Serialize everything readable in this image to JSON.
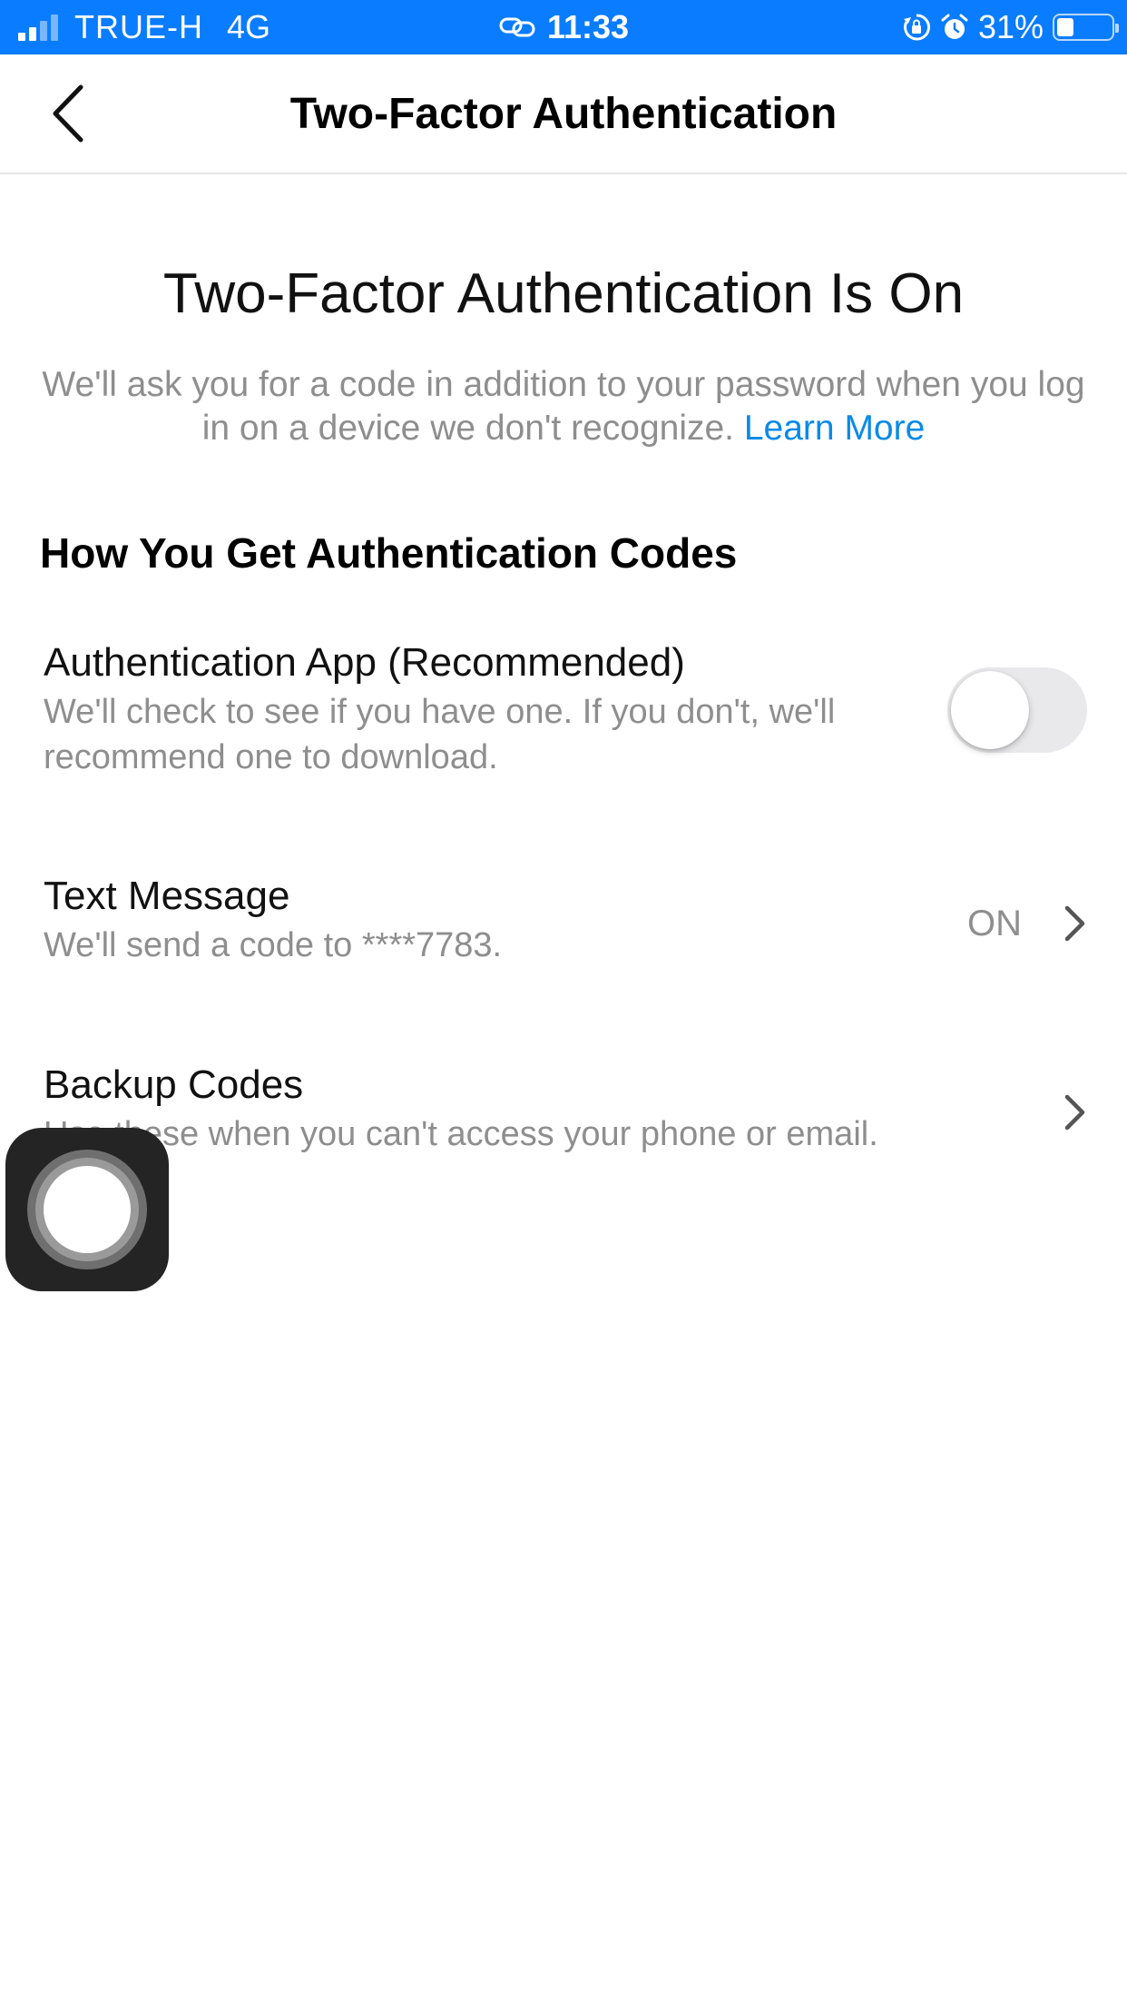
{
  "status_bar": {
    "carrier": "TRUE-H",
    "network": "4G",
    "time": "11:33",
    "battery_percent": "31%",
    "battery_level": 0.31,
    "icons": [
      "signal-icon",
      "link-icon",
      "orientation-lock-icon",
      "alarm-icon",
      "battery-icon"
    ]
  },
  "nav": {
    "title": "Two-Factor Authentication",
    "back_icon": "chevron-left-icon"
  },
  "hero": {
    "title": "Two-Factor Authentication Is On",
    "description": "We'll ask you for a code in addition to your password when you log in on a device we don't recognize. ",
    "learn_more": "Learn More"
  },
  "section": {
    "heading": "How You Get Authentication Codes"
  },
  "options": {
    "auth_app": {
      "title": "Authentication App (Recommended)",
      "subtitle": "We'll check to see if you have one. If you don't, we'll recommend one to download.",
      "toggle_on": false
    },
    "text_message": {
      "title": "Text Message",
      "subtitle": "We'll send a code to ****7783.",
      "status": "ON"
    },
    "backup_codes": {
      "title": "Backup Codes",
      "subtitle": "Use these when you can't access your phone or email."
    }
  },
  "colors": {
    "status_bar": "#0a7cff",
    "link": "#0a8ae6",
    "secondary_text": "#8e8e8e",
    "toggle_off": "#e9e9eb"
  }
}
